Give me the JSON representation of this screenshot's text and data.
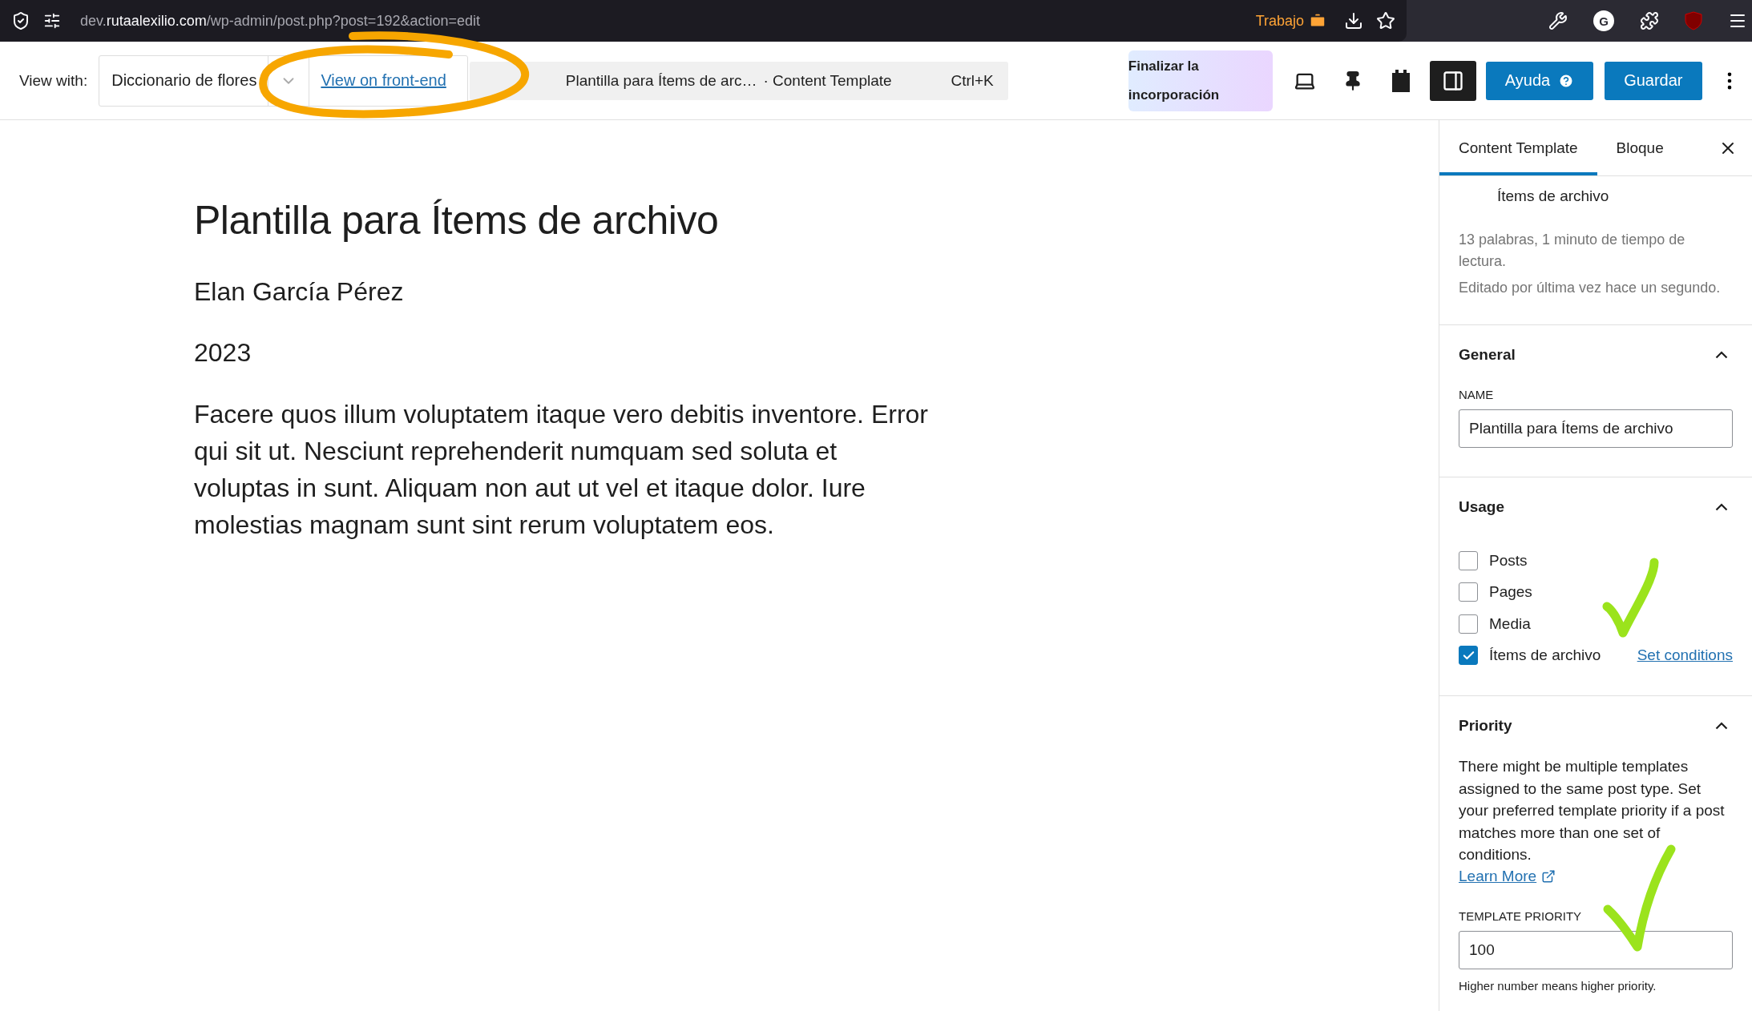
{
  "browser": {
    "url": {
      "subdomain": "dev.",
      "domain": "rutaalexilio.com",
      "path": "/wp-admin/post.php?post=192&action=edit"
    },
    "container": "Trabajo",
    "extension_letter": "G"
  },
  "toolbar": {
    "view_with_label": "View with:",
    "view_with_value": "Diccionario de flores",
    "front_end_link": "View on front-end",
    "command": {
      "title": "Plantilla para Ítems de arc…",
      "type": "· Content Template",
      "shortcut": "Ctrl+K"
    },
    "onboarding": "Finalizar la incorporación",
    "sidebar_toggle_on": true,
    "help": "Ayuda",
    "save": "Guardar"
  },
  "post": {
    "title": "Plantilla para Ítems de archivo",
    "author": "Elan García Pérez",
    "year": "2023",
    "body": "Facere quos illum voluptatem itaque vero debitis inventore. Error qui sit ut. Nesciunt reprehenderit numquam sed soluta et voluptas in sunt. Aliquam non aut ut vel et itaque dolor. Iure molestias magnam sunt sint rerum voluptatem eos."
  },
  "sidebar": {
    "tabs": [
      {
        "label": "Content Template",
        "selected": true
      },
      {
        "label": "Bloque",
        "selected": false
      }
    ],
    "template_name": "Ítems de archivo",
    "stats": "13 palabras, 1 minuto de tiempo de lectura.",
    "edited": "Editado por última vez hace un segundo.",
    "panels": [
      {
        "kind": "general",
        "title": "General",
        "expanded": true,
        "field_label": "NAME",
        "value": "Plantilla para Ítems de archivo"
      },
      {
        "kind": "usage",
        "title": "Usage",
        "expanded": true,
        "options": [
          {
            "label": "Posts",
            "checked": false
          },
          {
            "label": "Pages",
            "checked": false
          },
          {
            "label": "Media",
            "checked": false
          },
          {
            "label": "Ítems de archivo",
            "checked": true
          }
        ],
        "conditions_link": "Set conditions"
      },
      {
        "kind": "priority",
        "title": "Priority",
        "expanded": true,
        "description": "There might be multiple templates assigned to the same post type. Set your preferred template priority if a post matches more than one set of conditions.",
        "learn_more": "Learn More",
        "field_label": "TEMPLATE PRIORITY",
        "value": "100",
        "help": "Higher number means higher priority."
      }
    ]
  },
  "annotations": [
    {
      "kind": "circle"
    },
    {
      "kind": "check"
    },
    {
      "kind": "check"
    }
  ]
}
